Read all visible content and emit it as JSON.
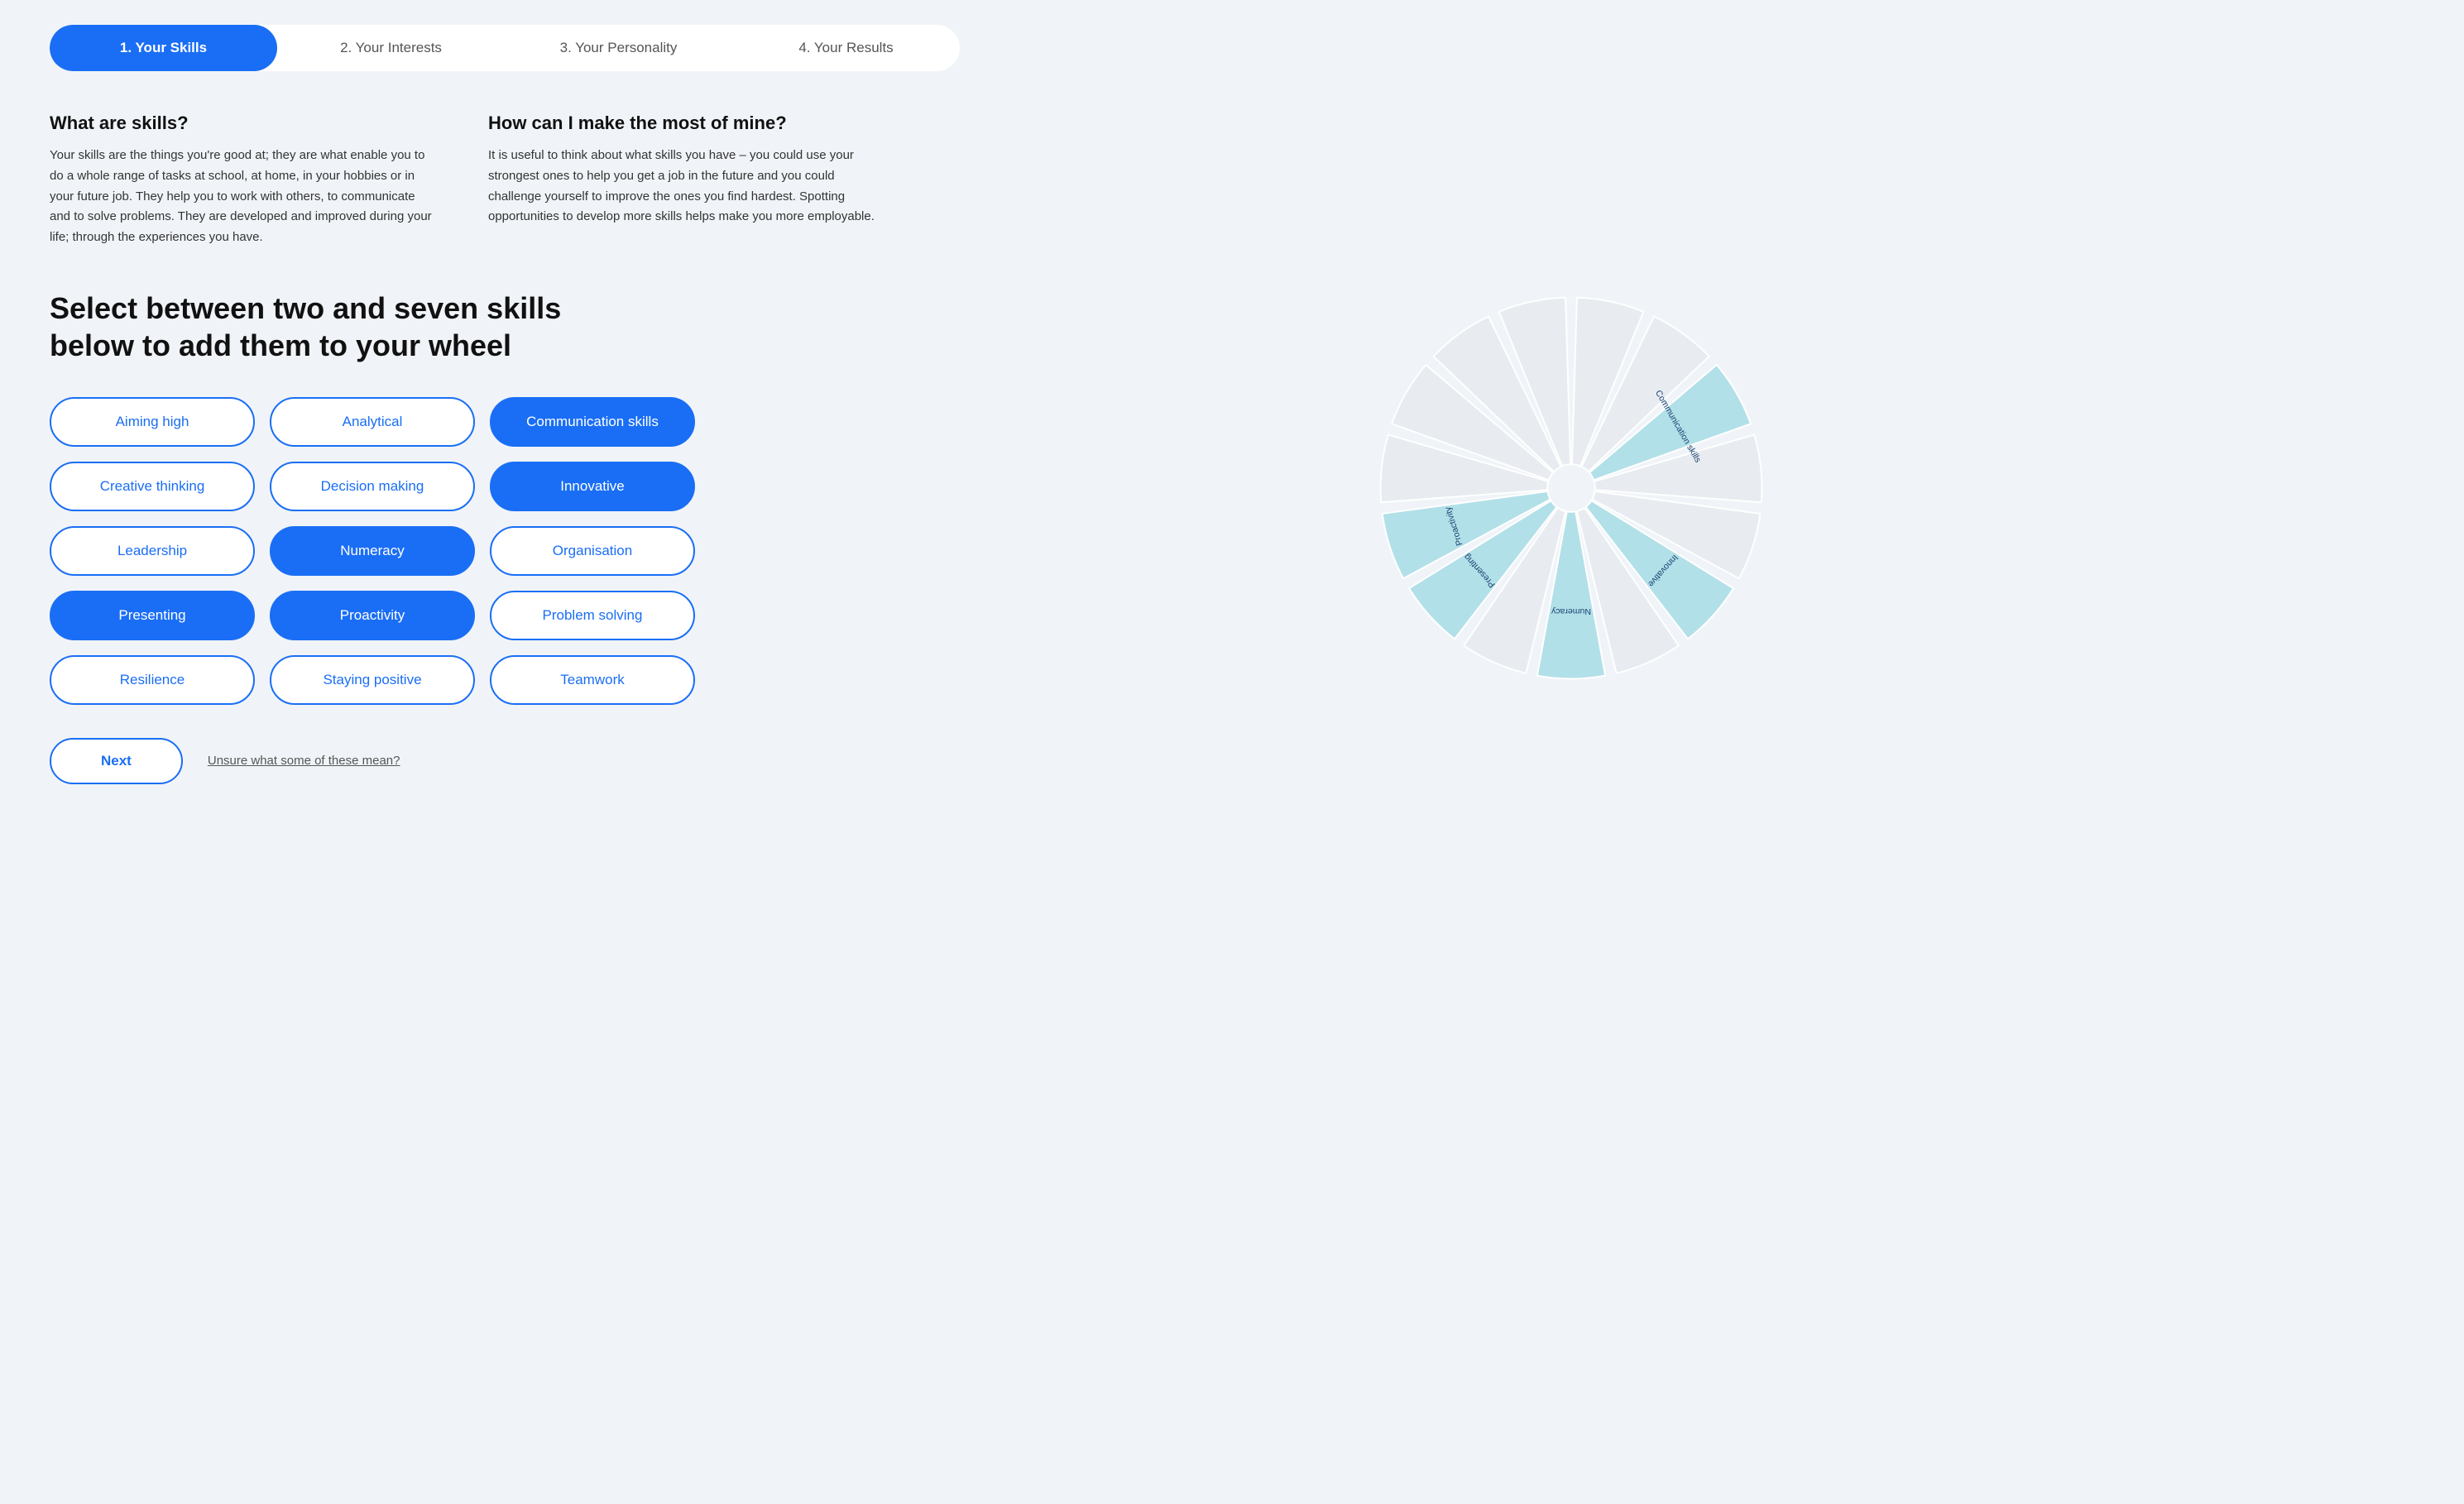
{
  "nav": {
    "steps": [
      {
        "label": "1. Your Skills",
        "active": true
      },
      {
        "label": "2. Your Interests",
        "active": false
      },
      {
        "label": "3. Your Personality",
        "active": false
      },
      {
        "label": "4. Your Results",
        "active": false
      }
    ]
  },
  "info": {
    "block1": {
      "title": "What are skills?",
      "body": "Your skills are the things you're good at; they are what enable you to do a whole range of tasks at school, at home, in your hobbies or in your future job. They help you to work with others, to communicate and to solve problems. They are developed and improved during your life; through the experiences you have."
    },
    "block2": {
      "title": "How can I make the most of mine?",
      "body": "It is useful to think about what skills you have – you could use your strongest ones to help you get a job in the future and you could challenge yourself to improve the ones you find hardest. Spotting opportunities to develop more skills helps make you more employable."
    }
  },
  "section": {
    "title": "Select between two and seven skills below to add them to your wheel"
  },
  "skills": [
    {
      "label": "Aiming high",
      "selected": false
    },
    {
      "label": "Analytical",
      "selected": false
    },
    {
      "label": "Communication skills",
      "selected": true
    },
    {
      "label": "Creative thinking",
      "selected": false
    },
    {
      "label": "Decision making",
      "selected": false
    },
    {
      "label": "Innovative",
      "selected": true
    },
    {
      "label": "Leadership",
      "selected": false
    },
    {
      "label": "Numeracy",
      "selected": true
    },
    {
      "label": "Organisation",
      "selected": false
    },
    {
      "label": "Presenting",
      "selected": true
    },
    {
      "label": "Proactivity",
      "selected": true
    },
    {
      "label": "Problem solving",
      "selected": false
    },
    {
      "label": "Resilience",
      "selected": false
    },
    {
      "label": "Staying positive",
      "selected": false
    },
    {
      "label": "Teamwork",
      "selected": false
    }
  ],
  "buttons": {
    "next": "Next",
    "unsure": "Unsure what some of these mean?"
  },
  "wheel": {
    "selected_labels": [
      "Communication skills",
      "Innovative",
      "Numeracy",
      "Presenting",
      "Proactivity"
    ],
    "accent_color": "#b2e0e8"
  }
}
